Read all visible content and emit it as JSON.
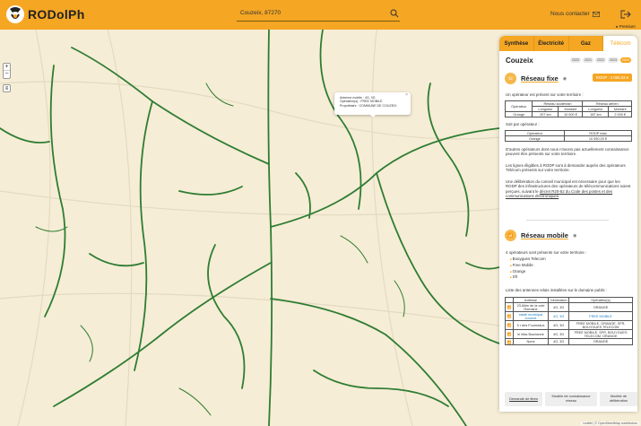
{
  "header": {
    "logo_text": "RODolPh",
    "search_value": "Couzeix, 87270",
    "contact_label": "Nous contacter",
    "premium_label": "Premium"
  },
  "map": {
    "zoom_in": "+",
    "zoom_out": "−",
    "popup": {
      "line1": "Antenne mobile : 4G, 3G",
      "line2": "Opérateur(s) : FREE MOBILE",
      "line3": "Propriétaire : COMMUNE DE COUZEIX",
      "close": "×"
    },
    "attribution": "Leaflet | © OpenStreetMap contributors"
  },
  "panel": {
    "tabs": [
      "Synthèse",
      "Électricité",
      "Gaz",
      "Télécom"
    ],
    "active_tab": "Télécom",
    "commune": "Couzeix",
    "years": [
      "2020",
      "2021",
      "2022",
      "2023",
      "2024"
    ],
    "selected_year": "2024",
    "fixe": {
      "title": "Réseau fixe",
      "total_badge": "RODP : 4 050,03 €",
      "intro": "Un opérateur est présent sur votre territoire :",
      "table1": {
        "head_operateur": "Opérateur",
        "head_souterrain": "Réseau souterrain",
        "head_aerien": "Réseau aérien",
        "head_longueur": "Longueur",
        "head_montant": "Montant",
        "rows": [
          {
            "operateur": "Orange",
            "s_long": "207 km",
            "s_mont": "10 000 €",
            "a_long": "187 km",
            "a_mont": "2 000 €"
          }
        ]
      },
      "soit": "Soit par opérateur :",
      "table2": {
        "head_operateur": "Opérateur",
        "head_rodp": "RODP total",
        "rows": [
          {
            "operateur": "Orange",
            "rodp": "10 050,03 €"
          }
        ]
      },
      "p1": "D'autres opérateurs dont nous n'avons pas actuellement connaissance peuvent être présents sur votre territoire.",
      "p2": "Les lignes éligibles à RODP sont à demander auprès des opérateurs Télécom présents sur votre territoire.",
      "p3_a": "Une délibération du conseil municipal est nécessaire pour que les RODP des infrastructures des opérateurs de télécommunications soient perçues, suivant le ",
      "p3_link": "décret R20-52 du Code des postes et des communications électroniques",
      "p3_b": "."
    },
    "mobile": {
      "title": "Réseau mobile",
      "intro": "4 opérateurs sont présents sur votre territoire :",
      "operators": [
        "Bouygues Telecom",
        "Free Mobile",
        "Orange",
        "Sfr"
      ],
      "list_intro": "Liste des antennes relais installées sur le domaine public :",
      "table": {
        "head_adresse": "Adresse",
        "head_generation": "Génération",
        "head_operateurs": "Opérateur(s)",
        "rows": [
          {
            "adresse": "23 Allée de la voie Romaine",
            "generation": "4G, 3G",
            "operateurs": "ORANGE",
            "hl": false
          },
          {
            "adresse": "stade municipal couzeix",
            "generation": "4G, 3G",
            "operateurs": "FREE MOBILE",
            "hl": true
          },
          {
            "adresse": "9 r des Fourneaux",
            "generation": "4G, 3G",
            "operateurs": "FREE MOBILE, ORANGE, SFR, BOUYGUES TELECOM",
            "hl": false
          },
          {
            "adresse": "le Mas Bourianne",
            "generation": "4G, 3G",
            "operateurs": "FREE MOBILE, SFR, BOUYGUES TELECOM, ORANGE",
            "hl": false
          },
          {
            "adresse": "None",
            "generation": "4G, 3G",
            "operateurs": "ORANGE",
            "hl": false
          }
        ]
      }
    },
    "buttons": {
      "demande": "Demande de titres",
      "modele_connaissance": "Modèle de connaissance réseau",
      "modele_deliberation": "Modèle de délibération"
    }
  },
  "colors": {
    "brand": "#f5a623",
    "network_line": "#2e7d32",
    "map_bg": "#f6edd6"
  }
}
